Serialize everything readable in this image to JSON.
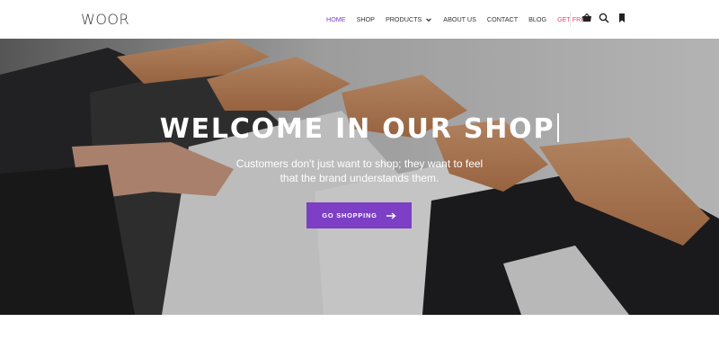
{
  "header": {
    "logo": "WOOR",
    "nav": [
      {
        "label": "HOME",
        "active": true
      },
      {
        "label": "SHOP"
      },
      {
        "label": "PRODUCTS",
        "has_dropdown": true
      },
      {
        "label": "ABOUT US"
      },
      {
        "label": "CONTACT"
      },
      {
        "label": "BLOG"
      },
      {
        "label": "GET FREE!"
      }
    ],
    "icons": [
      "cart-icon",
      "search-icon",
      "bookmark-icon"
    ]
  },
  "hero": {
    "title": "WELCOME IN OUR SHOP",
    "subtitle_line1": "Customers don't just want to shop; they want to feel",
    "subtitle_line2": "that the brand understands them.",
    "cta_label": "GO SHOPPING"
  },
  "colors": {
    "accent": "#7c3fc5",
    "nav_active": "#7b3fc4",
    "promo": "#e0457b"
  }
}
